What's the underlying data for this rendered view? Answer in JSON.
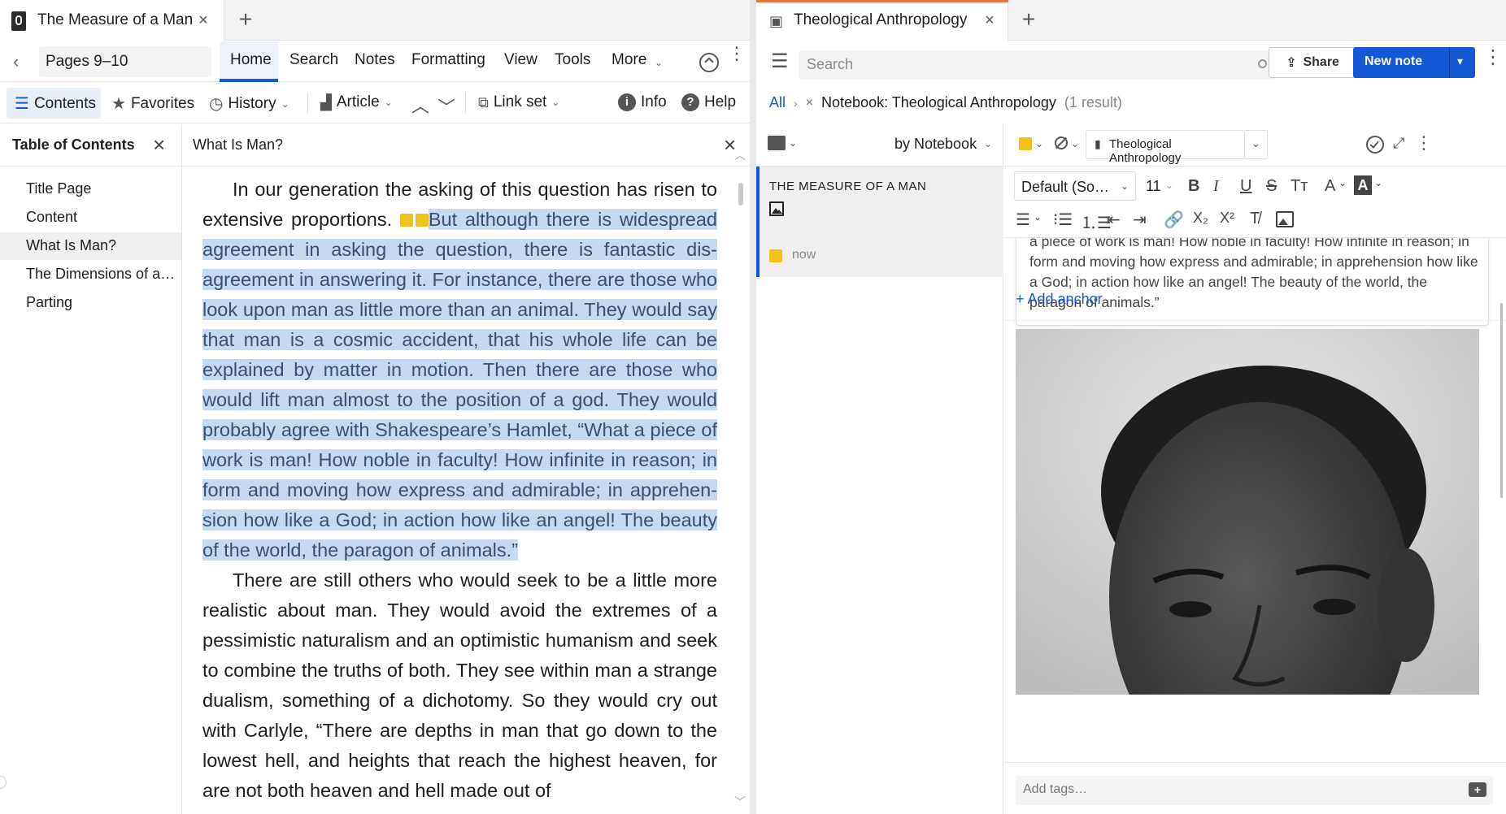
{
  "left": {
    "tab": {
      "title": "The Measure of a Man"
    },
    "pages_field": "Pages 9–10",
    "menu": [
      "Home",
      "Search",
      "Notes",
      "Formatting",
      "View",
      "Tools",
      "More"
    ],
    "toolbar": {
      "contents": "Contents",
      "favorites": "Favorites",
      "history": "History",
      "article": "Article",
      "linkset": "Link set",
      "info": "Info",
      "help": "Help"
    },
    "toc": {
      "title": "Table of Contents",
      "items": [
        "Title Page",
        "Content",
        "What Is Man?",
        "The Dimensions of a…",
        "Parting"
      ],
      "selected_index": 2
    },
    "reader": {
      "heading": "What Is Man?",
      "p1_plain": "In our generation the asking of this question has risen to extensive proportions.",
      "p1_highlight": "But although there is widespread agreement in asking the question, there is fantastic dis-agreement in answering it. For instance, there are those who look upon man as little more than an animal. They would say that man is a cosmic accident, that his whole life can be explained by matter in motion. Then there are those who would lift man almost to the position of a god. They would probably agree with Shakespeare’s Hamlet, “What a piece of work is man! How noble in faculty! How infinite in reason; in form and moving how express and admirable; in apprehen-sion how like a God; in action how like an angel! The beauty of the world, the paragon of animals.”",
      "p2": "There are still others who would seek to be a little more realistic about man. They would avoid the extremes of a pessimistic naturalism and an optimistic humanism and seek to combine the truths of both. They see within man a strange dualism, something of a dichotomy. So they would cry out with Carlyle, “There are depths in man that go down to the lowest hell, and heights that reach the highest heaven, for are not both heaven and hell made out of"
    }
  },
  "right": {
    "tab": {
      "title": "Theological Anthropology"
    },
    "search": {
      "placeholder": "Search"
    },
    "share_label": "Share",
    "new_note_label": "New note",
    "breadcrumb": {
      "all": "All",
      "filter": "Notebook: Theological Anthropology",
      "count": "(1 result)"
    },
    "list": {
      "sort": "by Notebook",
      "group_title": "THE MEASURE OF A MAN",
      "time": "now"
    },
    "editor": {
      "notebook": "Theological Anthropology",
      "font": "Default (So…",
      "size": "11",
      "quote": "a piece of work is man! How noble in faculty! How infinite in reason; in form and moving how express and admirable; in apprehension how like a God; in action how like an angel! The beauty of the world, the paragon of animals.”",
      "add_anchor": "+ Add anchor",
      "tags_placeholder": "Add tags…"
    }
  },
  "colors": {
    "accent_blue": "#1558d6",
    "highlight_bg": "#c5d9f0",
    "tab_accent": "#e8743b",
    "note_yellow": "#f2c21b"
  }
}
